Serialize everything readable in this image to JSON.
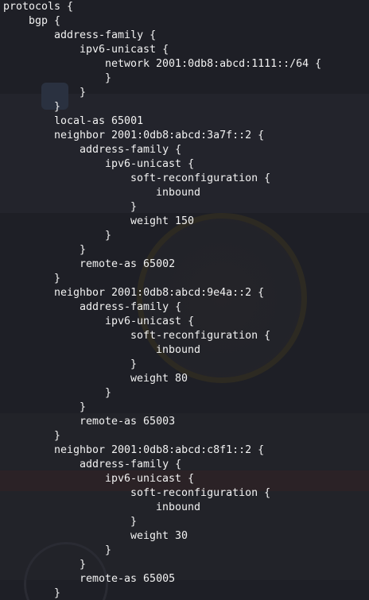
{
  "terminal": {
    "lines": [
      {
        "indent": 0,
        "text": "protocols {"
      },
      {
        "indent": 1,
        "text": "bgp {"
      },
      {
        "indent": 2,
        "text": "address-family {"
      },
      {
        "indent": 3,
        "text": "ipv6-unicast {"
      },
      {
        "indent": 4,
        "text": "network 2001:0db8:abcd:1111::/64 {"
      },
      {
        "indent": 4,
        "text": "}"
      },
      {
        "indent": 3,
        "text": "}"
      },
      {
        "indent": 2,
        "text": "}"
      },
      {
        "indent": 2,
        "text": "local-as 65001"
      },
      {
        "indent": 2,
        "text": "neighbor 2001:0db8:abcd:3a7f::2 {"
      },
      {
        "indent": 3,
        "text": "address-family {"
      },
      {
        "indent": 4,
        "text": "ipv6-unicast {"
      },
      {
        "indent": 5,
        "text": "soft-reconfiguration {"
      },
      {
        "indent": 6,
        "text": "inbound"
      },
      {
        "indent": 5,
        "text": "}"
      },
      {
        "indent": 5,
        "text": "weight 150"
      },
      {
        "indent": 4,
        "text": "}"
      },
      {
        "indent": 3,
        "text": "}"
      },
      {
        "indent": 3,
        "text": "remote-as 65002"
      },
      {
        "indent": 2,
        "text": "}"
      },
      {
        "indent": 2,
        "text": "neighbor 2001:0db8:abcd:9e4a::2 {"
      },
      {
        "indent": 3,
        "text": "address-family {"
      },
      {
        "indent": 4,
        "text": "ipv6-unicast {"
      },
      {
        "indent": 5,
        "text": "soft-reconfiguration {"
      },
      {
        "indent": 6,
        "text": "inbound"
      },
      {
        "indent": 5,
        "text": "}"
      },
      {
        "indent": 5,
        "text": "weight 80"
      },
      {
        "indent": 4,
        "text": "}"
      },
      {
        "indent": 3,
        "text": "}"
      },
      {
        "indent": 3,
        "text": "remote-as 65003"
      },
      {
        "indent": 2,
        "text": "}"
      },
      {
        "indent": 2,
        "text": "neighbor 2001:0db8:abcd:c8f1::2 {"
      },
      {
        "indent": 3,
        "text": "address-family {"
      },
      {
        "indent": 4,
        "text": "ipv6-unicast {"
      },
      {
        "indent": 5,
        "text": "soft-reconfiguration {"
      },
      {
        "indent": 6,
        "text": "inbound"
      },
      {
        "indent": 5,
        "text": "}"
      },
      {
        "indent": 5,
        "text": "weight 30"
      },
      {
        "indent": 4,
        "text": "}"
      },
      {
        "indent": 3,
        "text": "}"
      },
      {
        "indent": 3,
        "text": "remote-as 65005"
      },
      {
        "indent": 2,
        "text": "}"
      }
    ]
  },
  "colors": {
    "background": "#1e1f26",
    "text": "#f2f2f2"
  }
}
